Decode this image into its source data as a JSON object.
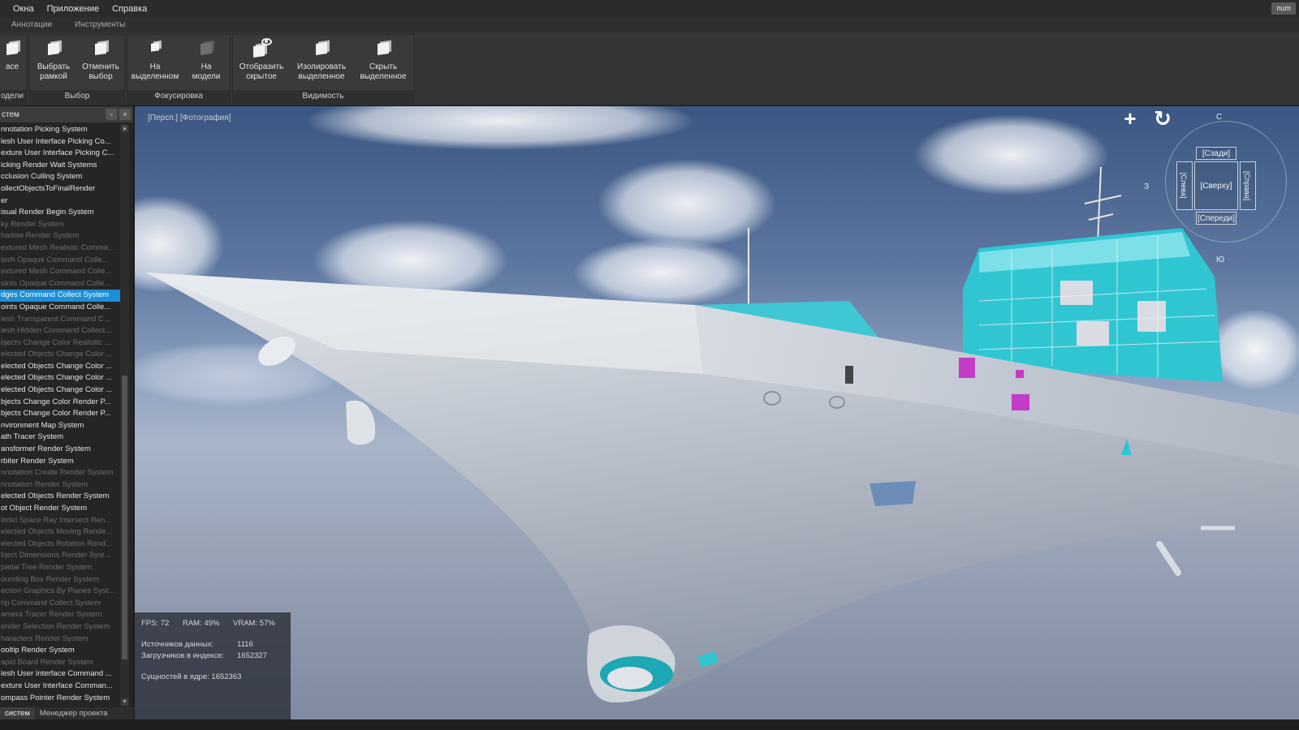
{
  "menubar": {
    "items": [
      "Окна",
      "Приложение",
      "Справка"
    ],
    "user_badge": "num"
  },
  "ribbon_tabs": [
    "Аннотации",
    "Инструменты"
  ],
  "ribbon": {
    "groups": [
      {
        "title": "одели",
        "buttons": [
          {
            "label": "ace",
            "icon": "cube-icon"
          }
        ]
      },
      {
        "title": "Выбор",
        "buttons": [
          {
            "label": "Выбрать\nрамкой",
            "icon": "select-box-icon"
          },
          {
            "label": "Отменить\nвыбор",
            "icon": "deselect-icon"
          }
        ]
      },
      {
        "title": "Фокусировка",
        "buttons": [
          {
            "label": "На\nвыделенном",
            "icon": "focus-selection-icon"
          },
          {
            "label": "На\nмодели",
            "icon": "focus-model-icon"
          }
        ]
      },
      {
        "title": "Видимость",
        "buttons": [
          {
            "label": "Отобразить\nскрытое",
            "icon": "show-hidden-icon"
          },
          {
            "label": "Изолировать\nвыделенное",
            "icon": "isolate-icon"
          },
          {
            "label": "Скрыть\nвыделенное",
            "icon": "hide-selected-icon"
          }
        ]
      }
    ]
  },
  "left_panel": {
    "title": "стем",
    "items": [
      {
        "text": "nnotation Picking System",
        "state": "normal"
      },
      {
        "text": "lesh User Interface Picking Co...",
        "state": "normal"
      },
      {
        "text": "exture User Interface Picking C...",
        "state": "normal"
      },
      {
        "text": "icking Render Wait Systems",
        "state": "normal"
      },
      {
        "text": "cclusion Culling System",
        "state": "normal"
      },
      {
        "text": "ollectObjectsToFinalRender",
        "state": "normal"
      },
      {
        "text": "er",
        "state": "normal"
      },
      {
        "text": "isual Render Begin System",
        "state": "normal"
      },
      {
        "text": "ky Render System",
        "state": "dim"
      },
      {
        "text": "hadow Render System",
        "state": "dim"
      },
      {
        "text": "extured Mesh Realistic Comma...",
        "state": "dim"
      },
      {
        "text": "lesh Opaque Command Colle...",
        "state": "dim"
      },
      {
        "text": "extured Mesh Command Colle...",
        "state": "dim"
      },
      {
        "text": "oints Opaque Command Colle...",
        "state": "dim"
      },
      {
        "text": "dges Command Collect System",
        "state": "selected"
      },
      {
        "text": "oints Opaque Command Colle...",
        "state": "normal"
      },
      {
        "text": "lesh Transparent Command C...",
        "state": "dim"
      },
      {
        "text": "lesh Hidden Command Collect...",
        "state": "dim"
      },
      {
        "text": "bjects Change Color Realistic ...",
        "state": "dim"
      },
      {
        "text": "elected Objects Change Color ...",
        "state": "dim"
      },
      {
        "text": "elected Objects Change Color ...",
        "state": "normal"
      },
      {
        "text": "elected Objects Change Color ...",
        "state": "normal"
      },
      {
        "text": "elected Objects Change Color ...",
        "state": "normal"
      },
      {
        "text": "bjects Change Color Render P...",
        "state": "normal"
      },
      {
        "text": "bjects Change Color Render P...",
        "state": "normal"
      },
      {
        "text": "nvironment Map System",
        "state": "normal"
      },
      {
        "text": "ath Tracer System",
        "state": "normal"
      },
      {
        "text": "ansformer Render System",
        "state": "normal"
      },
      {
        "text": "rbiter Render System",
        "state": "normal"
      },
      {
        "text": "nnotation Create Render System",
        "state": "dim"
      },
      {
        "text": "nnotation Render System",
        "state": "dim"
      },
      {
        "text": "elected Objects Render System",
        "state": "normal"
      },
      {
        "text": "ot Object Render System",
        "state": "normal"
      },
      {
        "text": "lodel Space Ray Intersect Ren...",
        "state": "dim"
      },
      {
        "text": "elected Objects Moving Rende...",
        "state": "dim"
      },
      {
        "text": "elected Objects Rotation Rend...",
        "state": "dim"
      },
      {
        "text": "bject Dimensions Render Syst...",
        "state": "dim"
      },
      {
        "text": "patial Tree Render System",
        "state": "dim"
      },
      {
        "text": "ounding Box Render System",
        "state": "dim"
      },
      {
        "text": "ection Graphics By Planes Syst...",
        "state": "dim"
      },
      {
        "text": "rip Command Collect System",
        "state": "dim"
      },
      {
        "text": "amera Tracer Render System",
        "state": "dim"
      },
      {
        "text": "ender Selection Render System",
        "state": "dim"
      },
      {
        "text": "haracters Render System",
        "state": "dim"
      },
      {
        "text": "ooltip Render System",
        "state": "normal"
      },
      {
        "text": "apid Board Render System",
        "state": "dim"
      },
      {
        "text": "lesh User Interface Command ...",
        "state": "normal"
      },
      {
        "text": "exture User Interface Comman...",
        "state": "normal"
      },
      {
        "text": "ompass Pointer Render System",
        "state": "normal"
      }
    ],
    "tabs": [
      "систем",
      "Менеджер проекта"
    ]
  },
  "viewport": {
    "label": "[Персп.] [Фотография]",
    "tools": {
      "add": "+",
      "rotate": "↻"
    },
    "navcube": {
      "back": "[Сзади]",
      "top": "[Сверху]",
      "front": "[Спереди]",
      "left": "[Слева]",
      "right": "[Справа]",
      "north": "С",
      "south": "Ю",
      "west": "З"
    },
    "stats": {
      "fps": "FPS: 72",
      "ram": "RAM: 49%",
      "vram": "VRAM: 57%",
      "sources_label": "Источников данных:",
      "sources_value": "1116",
      "loaders_label": "Загрузчиков в индексе:",
      "loaders_value": "1652327",
      "entities_label": "Сущностей в ядре:",
      "entities_value": "1652363"
    }
  },
  "colors": {
    "accent": "#1c8fd6",
    "cyan": "#2fc6d2",
    "magenta": "#c43bc7",
    "hull": "#c9ced6"
  }
}
